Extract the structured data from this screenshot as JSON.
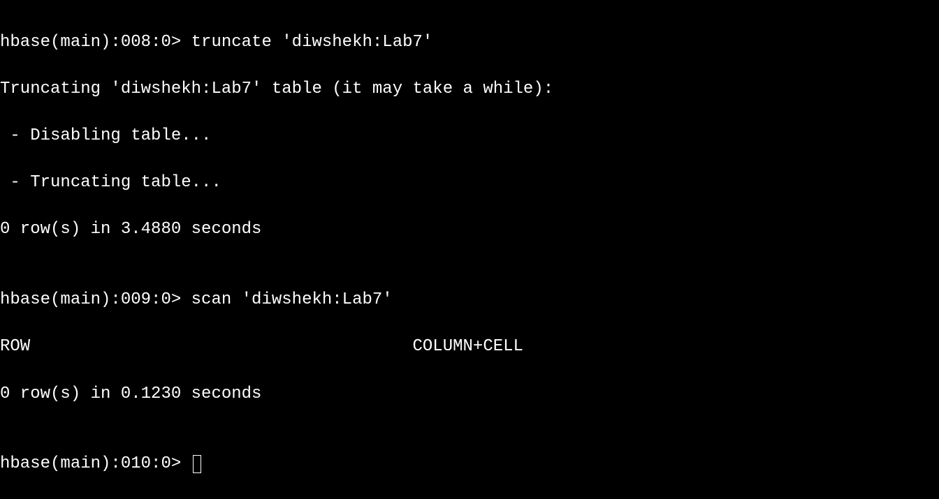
{
  "terminal": {
    "lines": {
      "l1": "hbase(main):008:0> truncate 'diwshekh:Lab7'",
      "l2": "Truncating 'diwshekh:Lab7' table (it may take a while):",
      "l3": " - Disabling table...",
      "l4": " - Truncating table...",
      "l5": "0 row(s) in 3.4880 seconds",
      "l6": "",
      "l7": "hbase(main):009:0> scan 'diwshekh:Lab7'",
      "l8": "ROW                                      COLUMN+CELL",
      "l9": "0 row(s) in 0.1230 seconds",
      "l10": "",
      "l11": "hbase(main):010:0> "
    }
  }
}
